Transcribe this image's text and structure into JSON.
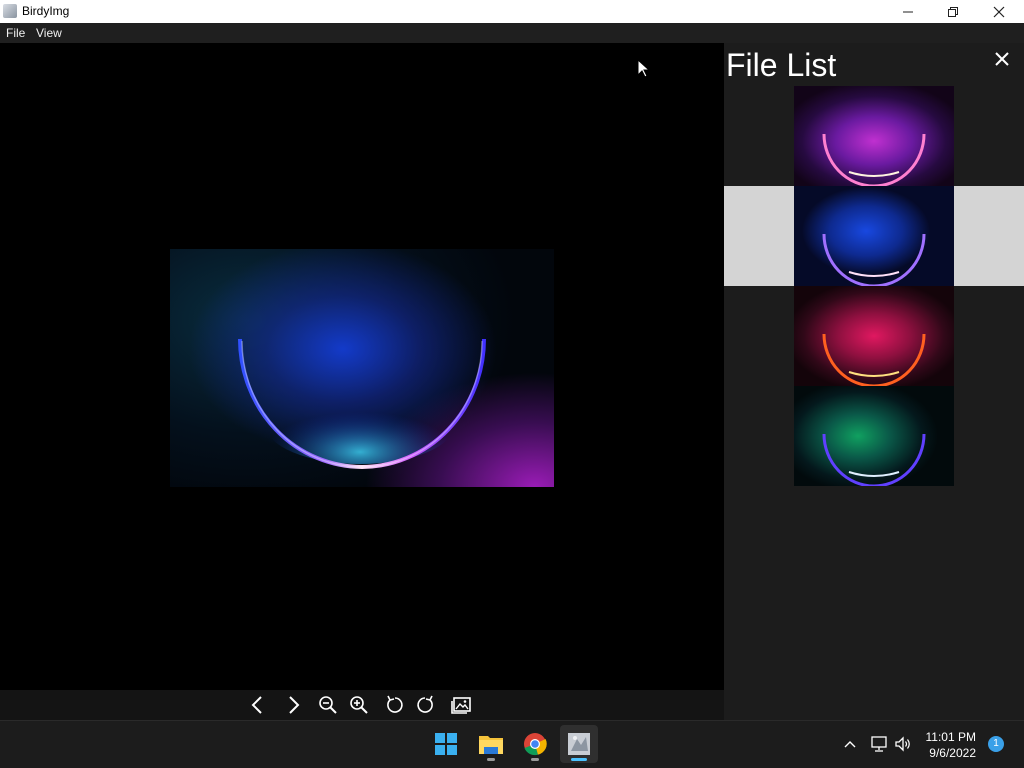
{
  "window": {
    "title": "BirdyImg"
  },
  "menu": {
    "items": [
      "File",
      "View"
    ]
  },
  "file_panel": {
    "title": "File List",
    "selected_index": 1,
    "thumbnails": [
      {
        "name": "bloom-purple"
      },
      {
        "name": "bloom-blue"
      },
      {
        "name": "bloom-red"
      },
      {
        "name": "bloom-green"
      }
    ]
  },
  "toolbar": {
    "buttons": [
      "previous",
      "next",
      "zoom-out",
      "zoom-in",
      "rotate-left",
      "rotate-right",
      "gallery"
    ]
  },
  "taskbar": {
    "apps": [
      "start",
      "file-explorer",
      "chrome",
      "birdyimg"
    ],
    "time": "11:01 PM",
    "date": "9/6/2022",
    "notification_count": "1"
  },
  "colors": {
    "titlebar": "#ffffff",
    "menubar": "#1f1f1f",
    "viewer_bg": "#000000",
    "panel_bg": "#1c1c1c",
    "selected_row": "#d4d4d4",
    "taskbar": "#1c1c1c",
    "accent": "#4cc2ff"
  }
}
